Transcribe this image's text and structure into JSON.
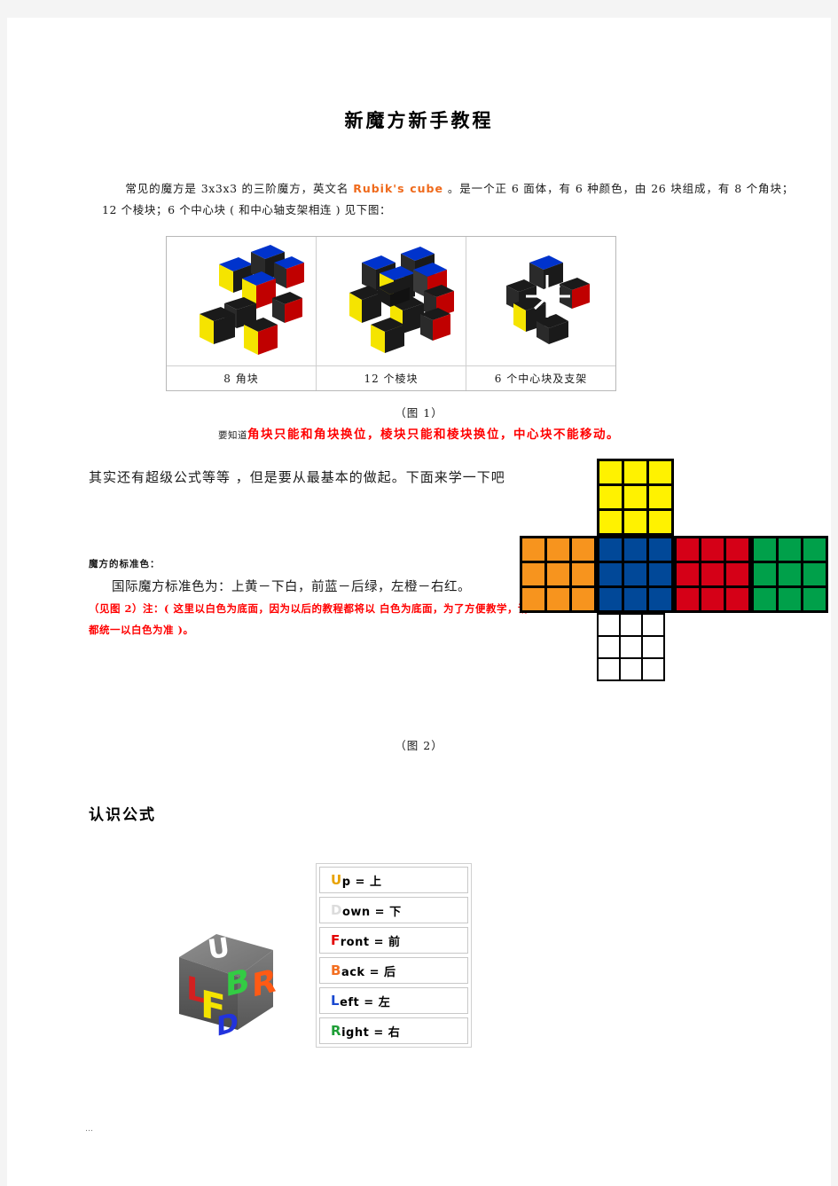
{
  "document": {
    "title": "新魔方新手教程",
    "intro_p1": "常见的魔方是 3x3x3 的三阶魔方，英文名 ",
    "intro_brand": "Rubik's  cube",
    "intro_p2": " 。是一个正 6 面体，有 6 种颜色，由 26 块组成，有 8 个角块；12 个棱块；6 个中心块 ( 和中心轴支架相连 ) 见下图："
  },
  "figure1": {
    "panels": [
      {
        "caption": "8 角块",
        "image": "corner-pieces-diagram"
      },
      {
        "caption": "12 个棱块",
        "image": "edge-pieces-diagram"
      },
      {
        "caption": "6 个中心块及支架",
        "image": "center-pieces-diagram"
      }
    ],
    "caption": "（图 1）",
    "warning_prefix": "要知道",
    "warning_red": "角块只能和角块换位，棱块只能和棱块换位，中心块不能移动。"
  },
  "body": {
    "paragraph": "其实还有超级公式等等 ，但是要从最基本的做起。下面来学一下吧",
    "standard_color_label": "魔方的标准色：",
    "standard_color_text": "国际魔方标准色为：上黄－下白，前蓝－后绿，左橙－右红。",
    "note_pre": "（见图 2）注：( 这里以白色为底面，因为以后的教程都将以 ",
    "note_blue": "白色",
    "note_post": "为底面，为了方便教学，请都统一以白色为准 )。"
  },
  "figure2": {
    "caption": "（图 2）",
    "net_faces": {
      "up": "yellow",
      "left": "orange",
      "front": "blue",
      "right": "red",
      "back": "green",
      "down": "white"
    },
    "colors": {
      "yellow": "#FFF200",
      "orange": "#F7941E",
      "blue": "#014898",
      "red": "#D50017",
      "green": "#00A04A",
      "white": "#FFFFFF",
      "grid": "#000000"
    }
  },
  "notation": {
    "heading": "认识公式",
    "cube_image": "labeled-cube-ufbrld",
    "cube_letters": [
      {
        "letter": "U",
        "color": "#FFFFFF"
      },
      {
        "letter": "L",
        "color": "#D32020"
      },
      {
        "letter": "F",
        "color": "#F4E400"
      },
      {
        "letter": "B",
        "color": "#33CC44"
      },
      {
        "letter": "R",
        "color": "#FF5A14"
      },
      {
        "letter": "D",
        "color": "#2233DD"
      }
    ],
    "rows": [
      {
        "lead": "U",
        "lead_color": "#E8A200",
        "rest": "p = 上"
      },
      {
        "lead": "D",
        "lead_color": "#DCDCDC",
        "rest": "own = 下"
      },
      {
        "lead": "F",
        "lead_color": "#E30000",
        "rest": "ront = 前"
      },
      {
        "lead": "B",
        "lead_color": "#F36F21",
        "rest": "ack = 后"
      },
      {
        "lead": "L",
        "lead_color": "#1A49D0",
        "rest": "eft = 左"
      },
      {
        "lead": "R",
        "lead_color": "#1E9E36",
        "rest": "ight = 右"
      }
    ]
  },
  "footer": {
    "mark": "…"
  }
}
